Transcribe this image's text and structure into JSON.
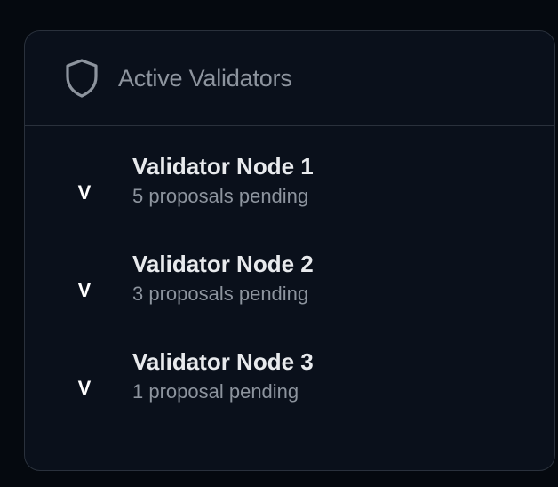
{
  "header": {
    "icon": "shield-icon",
    "title": "Active Validators"
  },
  "validators": [
    {
      "avatar": "V",
      "name": "Validator Node 1",
      "status": "5 proposals pending"
    },
    {
      "avatar": "V",
      "name": "Validator Node 2",
      "status": "3 proposals pending"
    },
    {
      "avatar": "V",
      "name": "Validator Node 3",
      "status": "1 proposal pending"
    }
  ],
  "colors": {
    "page_background": "#05090f",
    "card_background": "#0a101b",
    "border": "#2a313c",
    "muted_text": "#8d949e",
    "primary_text": "#e8eaed"
  }
}
